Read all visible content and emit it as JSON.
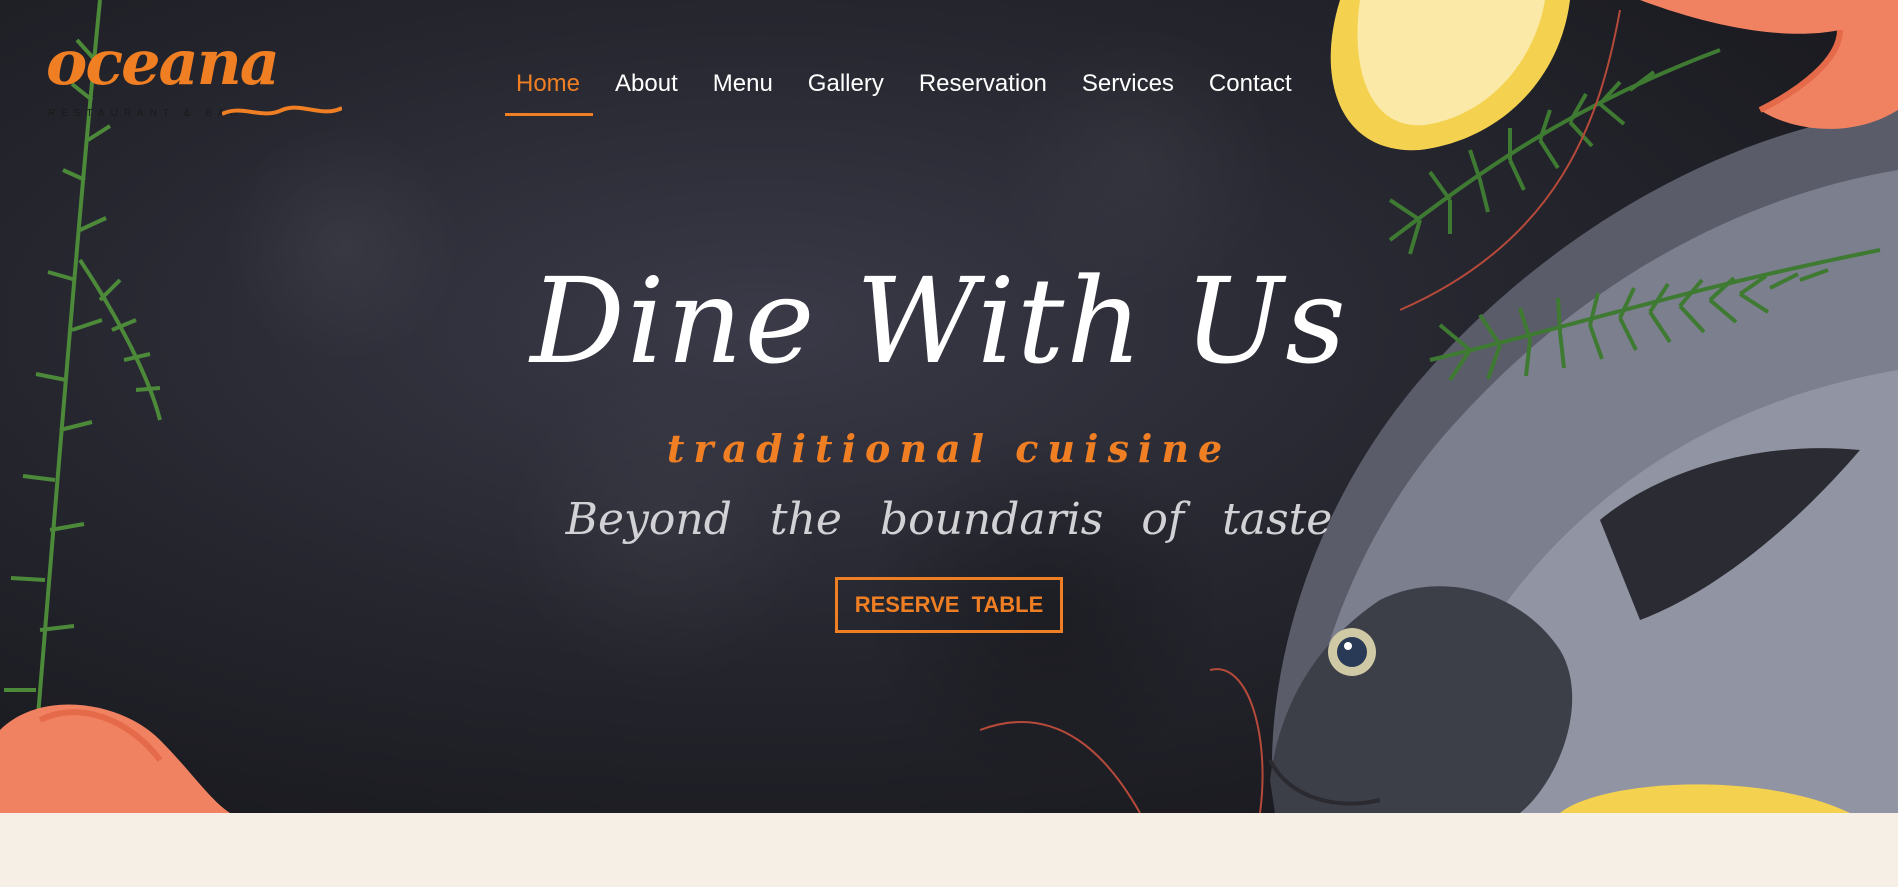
{
  "brand": {
    "logo_text": "oceana",
    "logo_subtitle": "RESTAURANT & BAR",
    "accent_color": "#f07f24"
  },
  "nav": {
    "items": [
      {
        "label": "Home",
        "active": true
      },
      {
        "label": "About",
        "active": false
      },
      {
        "label": "Menu",
        "active": false
      },
      {
        "label": "Gallery",
        "active": false
      },
      {
        "label": "Reservation",
        "active": false
      },
      {
        "label": "Services",
        "active": false
      },
      {
        "label": "Contact",
        "active": false
      }
    ]
  },
  "hero": {
    "title": "Dine With Us",
    "subtitle": "traditional cuisine",
    "tagline": "Beyond the boundaris of taste",
    "cta_label": "RESERVE TABLE"
  },
  "decor": {
    "images": [
      "rosemary-sprig",
      "lemon-slice",
      "shrimp",
      "sea-bream-fish"
    ]
  }
}
